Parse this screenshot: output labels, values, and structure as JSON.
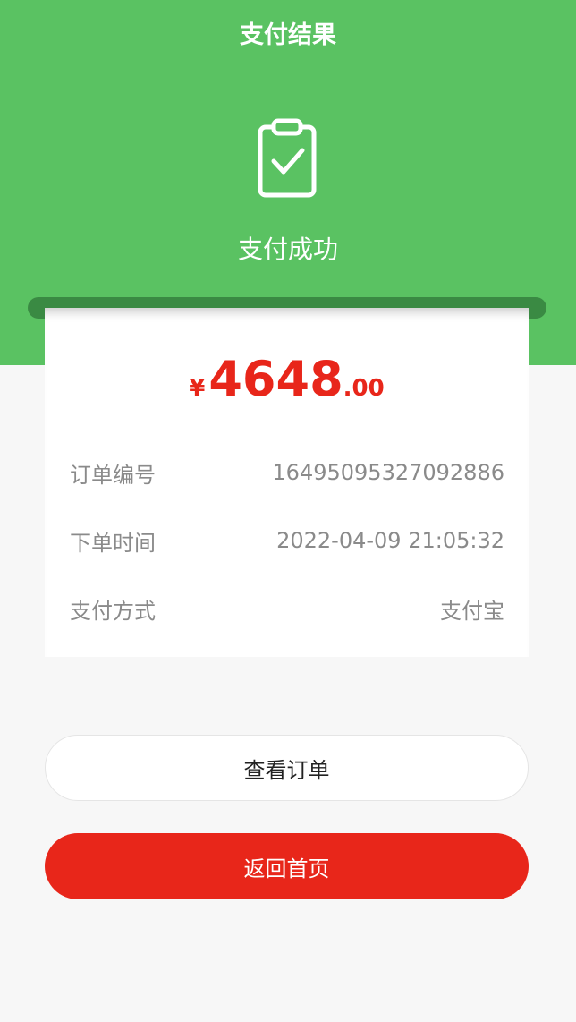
{
  "header": {
    "title": "支付结果",
    "icon": "clipboard-check-icon",
    "status_text": "支付成功"
  },
  "receipt": {
    "currency_symbol": "¥",
    "amount_integer": "4648",
    "amount_decimal": ".00",
    "rows": [
      {
        "label": "订单编号",
        "value": "16495095327092886"
      },
      {
        "label": "下单时间",
        "value": "2022-04-09 21:05:32"
      },
      {
        "label": "支付方式",
        "value": "支付宝"
      }
    ]
  },
  "actions": {
    "view_order_label": "查看订单",
    "back_home_label": "返回首页"
  },
  "colors": {
    "header_green": "#5ac262",
    "slot_green": "#3a8a43",
    "accent_red": "#e8261a",
    "background": "#f7f7f7"
  }
}
